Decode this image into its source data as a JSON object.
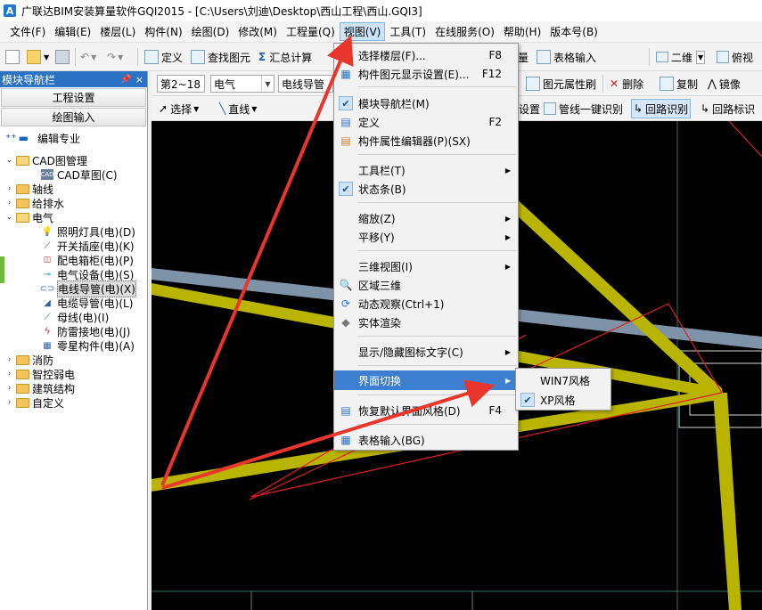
{
  "titlebar": {
    "app_icon": "A",
    "title": "广联达BIM安装算量软件GQI2015 - [C:\\Users\\刘迪\\Desktop\\西山工程\\西山.GQI3]"
  },
  "menubar": {
    "items": [
      "文件(F)",
      "编辑(E)",
      "楼层(L)",
      "构件(N)",
      "绘图(D)",
      "修改(M)",
      "工程量(Q)",
      "视图(V)",
      "工具(T)",
      "在线服务(O)",
      "帮助(H)",
      "版本号(B)"
    ]
  },
  "toolbar1": {
    "define": "定义",
    "find": "查找图元",
    "summary": "汇总计算",
    "table_input": "表格输入",
    "view2d": "二维",
    "viewtop": "俯视",
    "extra": "量"
  },
  "toolbar2": {
    "floor": "第2~18",
    "major": "电气",
    "component": "电线导管",
    "attr_panel": "图元属性刷",
    "delete": "删除",
    "copy": "复制",
    "mirror": "镜像"
  },
  "toolbar3": {
    "select": "选择",
    "line": "直线",
    "settings": "设置",
    "pipe_recognize": "管线一键识别",
    "loop_recognize": "回路识别",
    "loop_mark": "回路标识"
  },
  "sidebar": {
    "title": "模块导航栏",
    "pin": "ᵖ",
    "close": "×",
    "btn_project": "工程设置",
    "btn_draw": "绘图输入",
    "tool_label": "编辑专业",
    "tree": [
      {
        "label": "CAD图管理",
        "type": "folder",
        "expanded": true
      },
      {
        "label": "CAD草图(C)",
        "type": "leaf",
        "icon": "cad-icon"
      },
      {
        "label": "轴线",
        "type": "folder",
        "expanded": false
      },
      {
        "label": "给排水",
        "type": "folder",
        "expanded": false
      },
      {
        "label": "电气",
        "type": "folder",
        "expanded": true
      },
      {
        "label": "照明灯具(电)(D)",
        "type": "leaf",
        "icon": "bulb-icon"
      },
      {
        "label": "开关插座(电)(K)",
        "type": "leaf",
        "icon": "switch-icon"
      },
      {
        "label": "配电箱柜(电)(P)",
        "type": "leaf",
        "icon": "panel-icon"
      },
      {
        "label": "电气设备(电)(S)",
        "type": "leaf",
        "icon": "device-icon"
      },
      {
        "label": "电线导管(电)(X)",
        "type": "leaf",
        "icon": "conduit-icon",
        "selected": true
      },
      {
        "label": "电缆导管(电)(L)",
        "type": "leaf",
        "icon": "cable-icon"
      },
      {
        "label": "母线(电)(I)",
        "type": "leaf",
        "icon": "busbar-icon"
      },
      {
        "label": "防雷接地(电)(J)",
        "type": "leaf",
        "icon": "lightning-icon"
      },
      {
        "label": "零星构件(电)(A)",
        "type": "leaf",
        "icon": "grid-icon"
      },
      {
        "label": "消防",
        "type": "folder",
        "expanded": false
      },
      {
        "label": "智控弱电",
        "type": "folder",
        "expanded": false
      },
      {
        "label": "建筑结构",
        "type": "folder",
        "expanded": false
      },
      {
        "label": "自定义",
        "type": "folder",
        "expanded": false
      }
    ]
  },
  "view_menu": {
    "items": [
      {
        "label": "选择楼层(F)...",
        "shortcut": "F8",
        "icon": "floor-icon"
      },
      {
        "label": "构件图元显示设置(E)...",
        "shortcut": "F12",
        "icon": "display-icon"
      },
      {
        "label": "模块导航栏(M)",
        "checked": true
      },
      {
        "label": "定义",
        "shortcut": "F2",
        "icon": "define-icon"
      },
      {
        "label": "构件属性编辑器(P)(SX)",
        "icon": "property-icon"
      },
      {
        "label": "工具栏(T)",
        "submenu": true
      },
      {
        "label": "状态条(B)",
        "checked": true
      },
      {
        "label": "缩放(Z)",
        "submenu": true
      },
      {
        "label": "平移(Y)",
        "submenu": true
      },
      {
        "label": "三维视图(I)",
        "submenu": true
      },
      {
        "label": "区域三维",
        "icon": "zone3d-icon"
      },
      {
        "label": "动态观察(Ctrl+1)",
        "icon": "orbit-icon"
      },
      {
        "label": "实体渲染",
        "icon": "render-icon"
      },
      {
        "label": "显示/隐藏图标文字(C)",
        "submenu": true
      },
      {
        "label": "界面切换",
        "submenu": true,
        "highlighted": true
      },
      {
        "label": "恢复默认界面风格(D)",
        "shortcut": "F4",
        "icon": "restore-icon"
      },
      {
        "label": "表格输入(BG)",
        "icon": "table-icon"
      }
    ]
  },
  "sub_menu": {
    "items": [
      {
        "label": "WIN7风格",
        "checked": false
      },
      {
        "label": "XP风格",
        "checked": true
      }
    ]
  },
  "colors": {
    "accent": "#3c7fd0",
    "canvas": "#000000",
    "conduit": "#b8b400",
    "arrow": "#e8362c"
  }
}
